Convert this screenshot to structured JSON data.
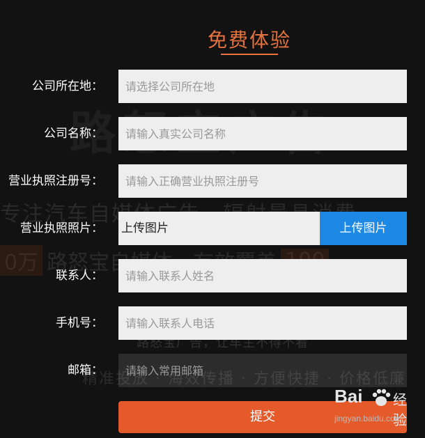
{
  "background_text": {
    "line1": "路怒宝广告",
    "line2": "专注汽车自媒体广告，辐射最具消费",
    "line3_left": "0万",
    "line3_mid": "路怒宝自媒体，有效覆盖",
    "line3_right": "100",
    "line4": "路怒宝广告，让车主不得不看",
    "line5": "精准投放 · 海效传播 · 方便快捷 · 价格低廉"
  },
  "title": "免费体验",
  "form": {
    "company_location": {
      "label": "公司所在地：",
      "placeholder": "请选择公司所在地",
      "value": ""
    },
    "company_name": {
      "label": "公司名称：",
      "placeholder": "请输入真实公司名称",
      "value": ""
    },
    "license_number": {
      "label": "营业执照注册号：",
      "placeholder": "请输入正确营业执照注册号",
      "value": ""
    },
    "license_photo": {
      "label": "营业执照照片：",
      "box_text": "上传图片",
      "button_label": "上传图片"
    },
    "contact": {
      "label": "联系人：",
      "placeholder": "请输入联系人姓名",
      "value": ""
    },
    "phone": {
      "label": "手机号：",
      "placeholder": "请输入联系人电话",
      "value": ""
    },
    "email": {
      "label": "邮箱：",
      "placeholder": "请输入常用邮箱",
      "value": ""
    },
    "submit_label": "提交"
  },
  "watermark": {
    "brand": "Bai",
    "text": "经验",
    "url": "jingyan.baidu.com"
  },
  "colors": {
    "accent": "#e7733f",
    "submit": "#e45a2a",
    "upload_button": "#1e88e5",
    "field_bg": "#eeeeee",
    "page_bg": "#121212"
  }
}
